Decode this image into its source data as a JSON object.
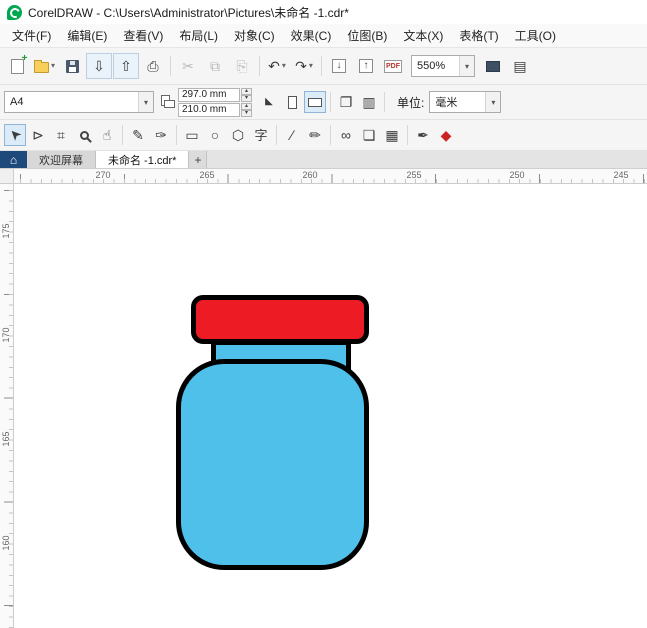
{
  "titlebar": {
    "title": "CorelDRAW - C:\\Users\\Administrator\\Pictures\\未命名 -1.cdr*"
  },
  "menubar": {
    "items": [
      "文件(F)",
      "编辑(E)",
      "查看(V)",
      "布局(L)",
      "对象(C)",
      "效果(C)",
      "位图(B)",
      "文本(X)",
      "表格(T)",
      "工具(O)"
    ]
  },
  "toolbar": {
    "zoom_level": "550%"
  },
  "property_bar": {
    "preset": "A4",
    "page_width": "297.0 mm",
    "page_height": "210.0 mm",
    "units_label": "单位:",
    "units_value": "毫米"
  },
  "tabbar": {
    "welcome_tab": "欢迎屏幕",
    "document_tab": "未命名 -1.cdr*",
    "new_tab": "+"
  },
  "rulers": {
    "horizontal": [
      "270",
      "265",
      "260",
      "255",
      "250",
      "245"
    ],
    "vertical": [
      "175",
      "170",
      "165",
      "160"
    ]
  },
  "glyphs": {
    "caret_down": "▾",
    "plus": "+",
    "home": "⌂",
    "cloud_open": "⇩",
    "cloud_save": "⇧",
    "print": "⎙",
    "cut": "✂",
    "copy": "⧉",
    "paste": "⎘",
    "undo": "↶",
    "redo": "↷",
    "import": "↓",
    "export": "↑",
    "pdf": "PDF",
    "show_rulers": "▤",
    "pages": "❐",
    "page_layout": "▥",
    "spin_up": "▴",
    "spin_down": "▾",
    "nib": "◣",
    "pick": "➤",
    "shape": "⊳",
    "crop": "⌗",
    "pan": "☝",
    "freehand": "✎",
    "artistic_media": "✑",
    "rectangle": "▭",
    "ellipse": "○",
    "polygon": "⬡",
    "text": "字",
    "dimension": "∕",
    "pen": "✏",
    "eyedropper": "∞",
    "outline_pen": "❏",
    "fill_pattern": "▦",
    "color_dropper": "✒",
    "outline_color": "◆"
  },
  "canvas": {
    "jar": {
      "cap_fill": "#ed1c24",
      "body_fill": "#4fc0ea",
      "outline": "#000000"
    }
  }
}
